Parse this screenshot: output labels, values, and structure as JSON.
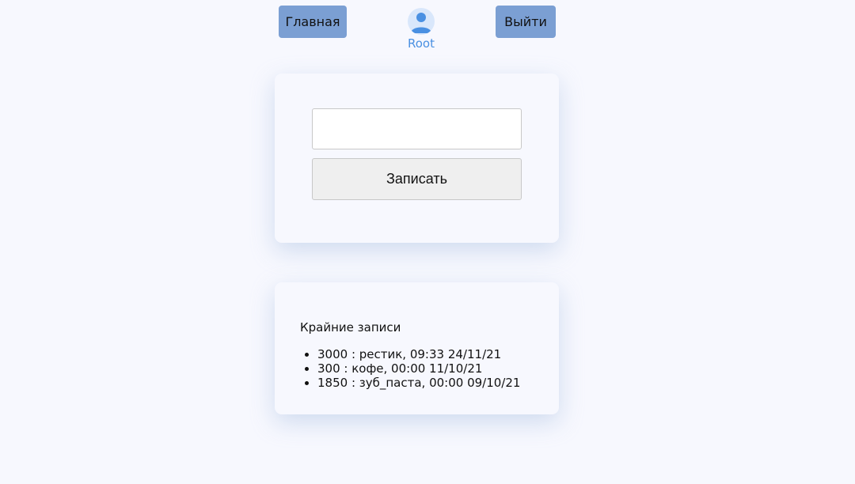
{
  "nav": {
    "home_label": "Главная",
    "exit_label": "Выйти"
  },
  "user": {
    "name": "Root",
    "icon": "user-avatar-icon"
  },
  "form": {
    "input_value": "",
    "submit_label": "Записать"
  },
  "records": {
    "title": "Крайние записи",
    "items": [
      "3000 : рестик, 09:33 24/11/21",
      "300 : кофе, 00:00 11/10/21",
      "1850 : зуб_паста, 00:00 09/10/21"
    ]
  },
  "colors": {
    "background": "#f7f8fe",
    "nav_button": "#7b9fd3",
    "user_accent": "#4a90e2"
  }
}
